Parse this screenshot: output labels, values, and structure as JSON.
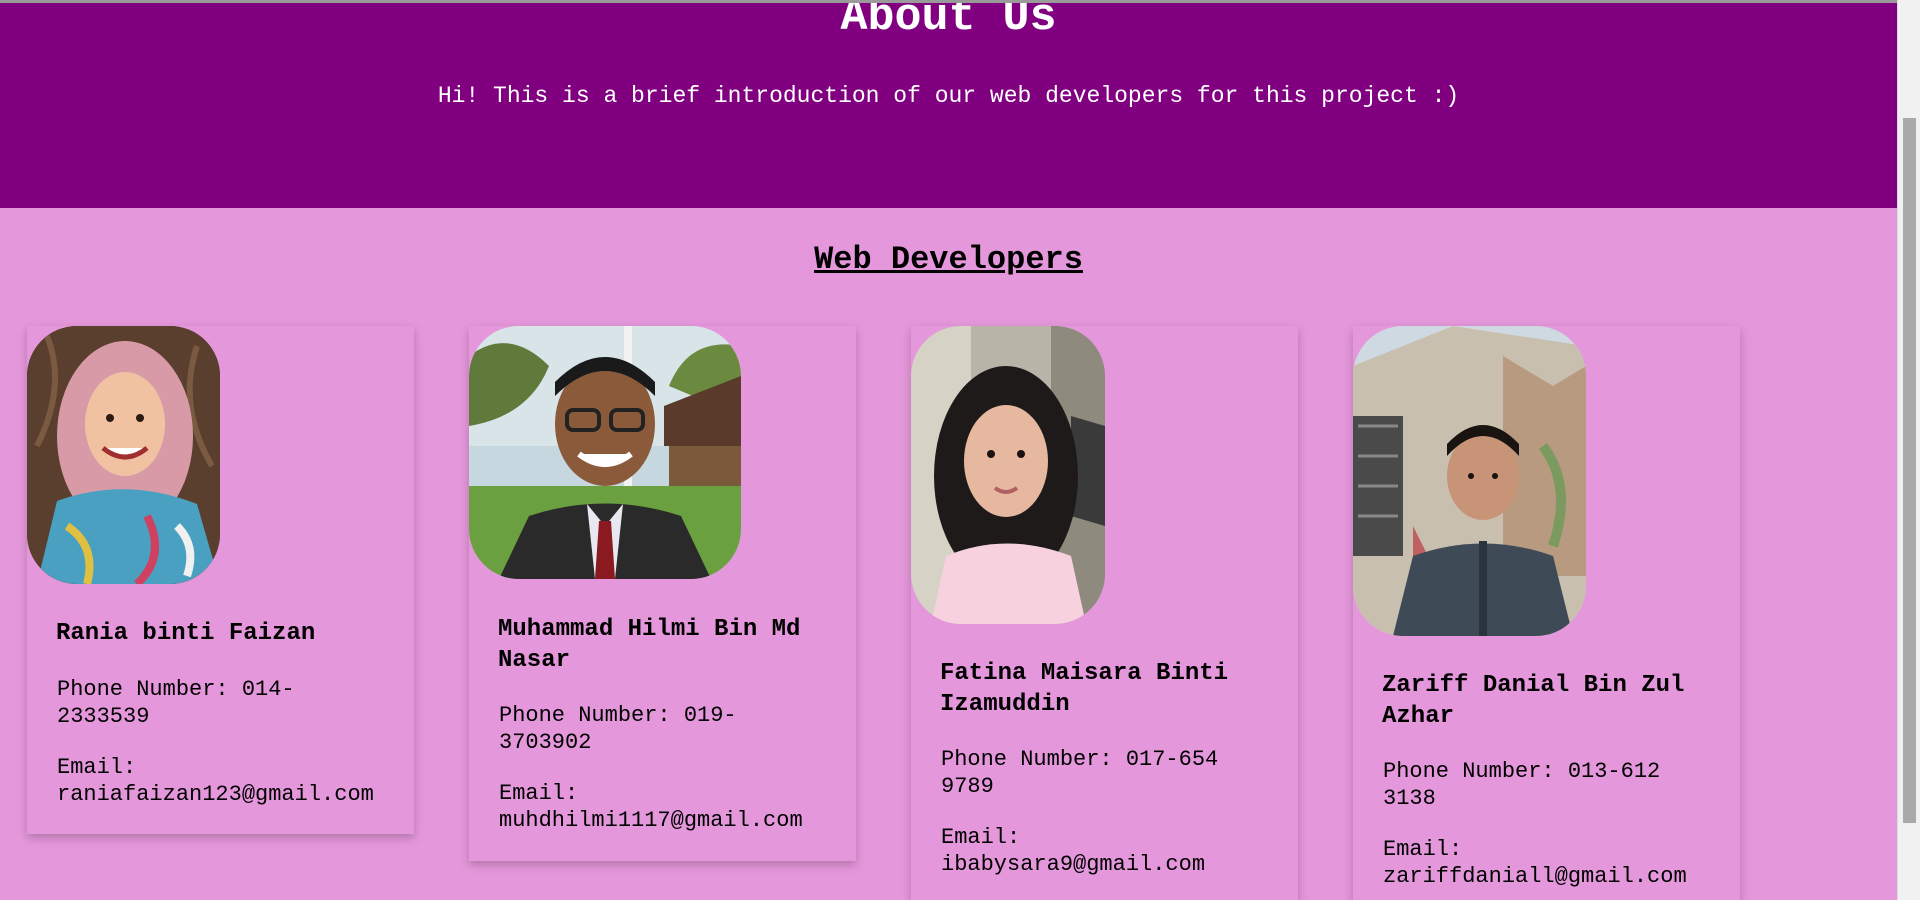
{
  "hero": {
    "title": "About Us",
    "subtitle": "Hi! This is a brief introduction of our web developers for this project :)"
  },
  "section": {
    "title": "Web Developers"
  },
  "developers": [
    {
      "name": "Rania binti Faizan",
      "phone": "Phone Number: 014-\n2333539",
      "email": "Email:\nraniafaizan123@gmail.com",
      "photo_icon": "profile-photo"
    },
    {
      "name": "Muhammad Hilmi Bin Md Nasar",
      "phone": "Phone Number: 019-\n3703902",
      "email": "Email:\nmuhdhilmi1117@gmail.com",
      "photo_icon": "profile-photo"
    },
    {
      "name": "Fatina Maisara Binti Izamuddin",
      "phone": "Phone Number: 017-654\n9789",
      "email": "Email:\nibabysara9@gmail.com",
      "photo_icon": "profile-photo"
    },
    {
      "name": "Zariff Danial Bin Zul Azhar",
      "phone": "Phone Number: 013-612\n3138",
      "email": "Email:\nzariffdaniall@gmail.com",
      "photo_icon": "profile-photo"
    }
  ],
  "colors": {
    "hero_bg": "#800080",
    "page_bg": "#e597db",
    "text": "#000000"
  }
}
